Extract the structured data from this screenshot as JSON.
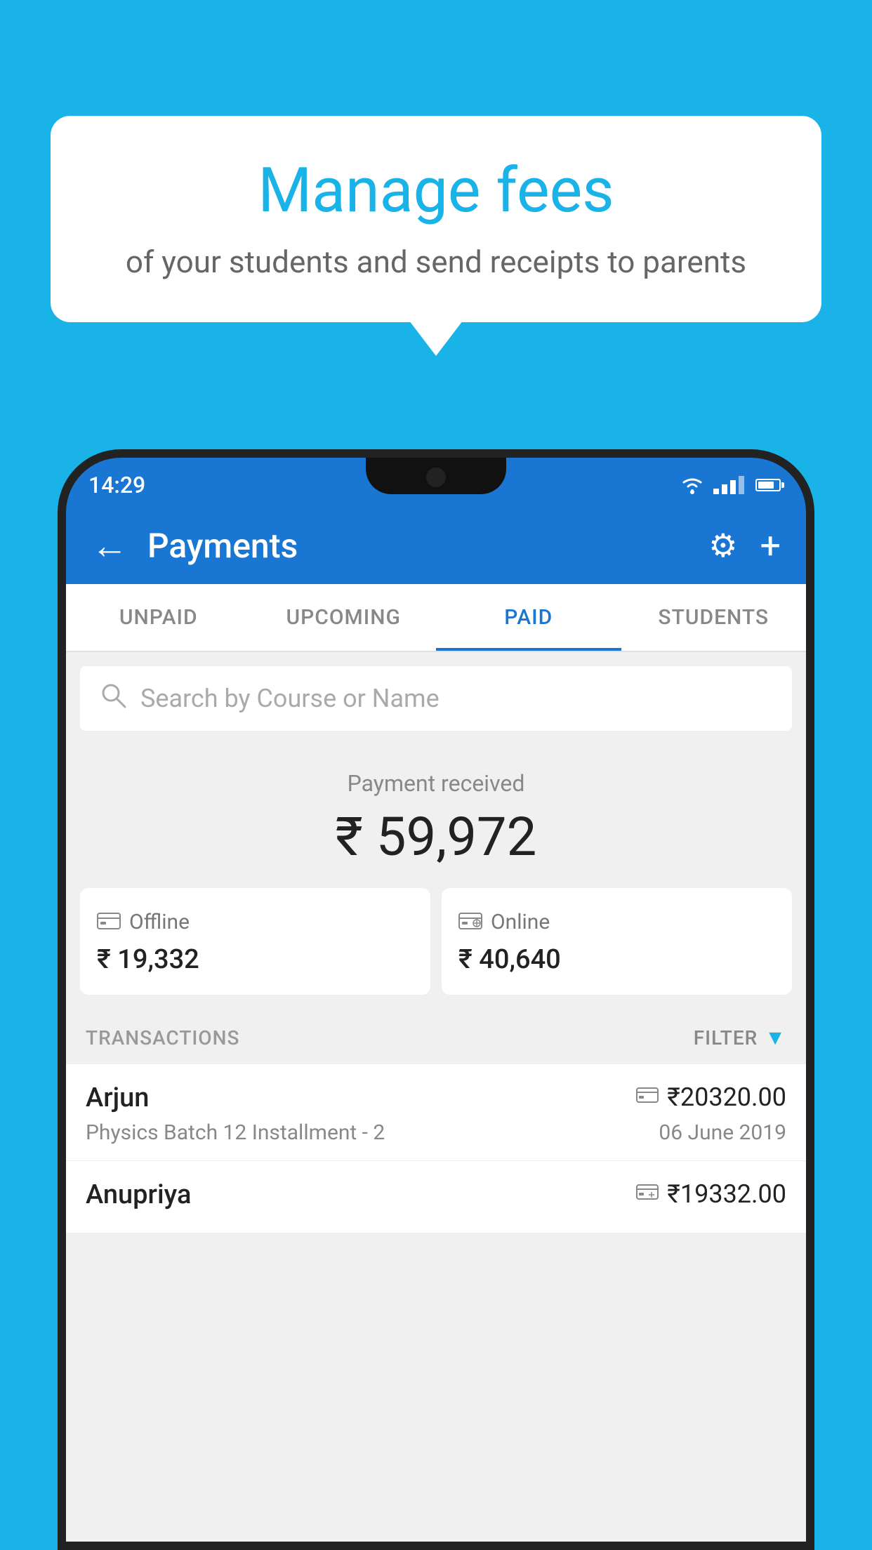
{
  "background_color": "#1ab3e8",
  "bubble": {
    "title": "Manage fees",
    "subtitle": "of your students and send receipts to parents"
  },
  "status_bar": {
    "time": "14:29"
  },
  "app_bar": {
    "title": "Payments",
    "back_label": "←",
    "settings_label": "⚙",
    "add_label": "+"
  },
  "tabs": [
    {
      "label": "UNPAID",
      "active": false
    },
    {
      "label": "UPCOMING",
      "active": false
    },
    {
      "label": "PAID",
      "active": true
    },
    {
      "label": "STUDENTS",
      "active": false
    }
  ],
  "search": {
    "placeholder": "Search by Course or Name"
  },
  "payment_summary": {
    "label": "Payment received",
    "amount": "₹ 59,972",
    "offline_label": "Offline",
    "offline_amount": "₹ 19,332",
    "online_label": "Online",
    "online_amount": "₹ 40,640"
  },
  "transactions": {
    "header_label": "TRANSACTIONS",
    "filter_label": "FILTER",
    "items": [
      {
        "name": "Arjun",
        "course": "Physics Batch 12 Installment - 2",
        "amount": "₹20320.00",
        "date": "06 June 2019",
        "type": "online"
      },
      {
        "name": "Anupriya",
        "course": "",
        "amount": "₹19332.00",
        "date": "",
        "type": "offline"
      }
    ]
  }
}
